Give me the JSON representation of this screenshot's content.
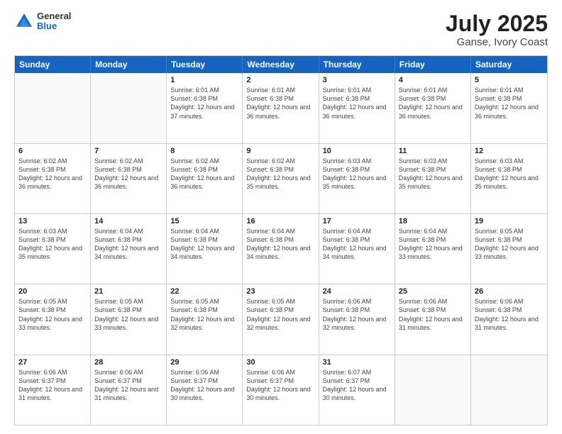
{
  "logo": {
    "line1": "General",
    "line2": "Blue"
  },
  "title": "July 2025",
  "subtitle": "Ganse, Ivory Coast",
  "days_of_week": [
    "Sunday",
    "Monday",
    "Tuesday",
    "Wednesday",
    "Thursday",
    "Friday",
    "Saturday"
  ],
  "weeks": [
    [
      {
        "day": "",
        "empty": true
      },
      {
        "day": "",
        "empty": true
      },
      {
        "day": "1",
        "sunrise": "Sunrise: 6:01 AM",
        "sunset": "Sunset: 6:38 PM",
        "daylight": "Daylight: 12 hours and 37 minutes."
      },
      {
        "day": "2",
        "sunrise": "Sunrise: 6:01 AM",
        "sunset": "Sunset: 6:38 PM",
        "daylight": "Daylight: 12 hours and 36 minutes."
      },
      {
        "day": "3",
        "sunrise": "Sunrise: 6:01 AM",
        "sunset": "Sunset: 6:38 PM",
        "daylight": "Daylight: 12 hours and 36 minutes."
      },
      {
        "day": "4",
        "sunrise": "Sunrise: 6:01 AM",
        "sunset": "Sunset: 6:38 PM",
        "daylight": "Daylight: 12 hours and 36 minutes."
      },
      {
        "day": "5",
        "sunrise": "Sunrise: 6:01 AM",
        "sunset": "Sunset: 6:38 PM",
        "daylight": "Daylight: 12 hours and 36 minutes."
      }
    ],
    [
      {
        "day": "6",
        "sunrise": "Sunrise: 6:02 AM",
        "sunset": "Sunset: 6:38 PM",
        "daylight": "Daylight: 12 hours and 36 minutes."
      },
      {
        "day": "7",
        "sunrise": "Sunrise: 6:02 AM",
        "sunset": "Sunset: 6:38 PM",
        "daylight": "Daylight: 12 hours and 36 minutes."
      },
      {
        "day": "8",
        "sunrise": "Sunrise: 6:02 AM",
        "sunset": "Sunset: 6:38 PM",
        "daylight": "Daylight: 12 hours and 36 minutes."
      },
      {
        "day": "9",
        "sunrise": "Sunrise: 6:02 AM",
        "sunset": "Sunset: 6:38 PM",
        "daylight": "Daylight: 12 hours and 35 minutes."
      },
      {
        "day": "10",
        "sunrise": "Sunrise: 6:03 AM",
        "sunset": "Sunset: 6:38 PM",
        "daylight": "Daylight: 12 hours and 35 minutes."
      },
      {
        "day": "11",
        "sunrise": "Sunrise: 6:03 AM",
        "sunset": "Sunset: 6:38 PM",
        "daylight": "Daylight: 12 hours and 35 minutes."
      },
      {
        "day": "12",
        "sunrise": "Sunrise: 6:03 AM",
        "sunset": "Sunset: 6:38 PM",
        "daylight": "Daylight: 12 hours and 35 minutes."
      }
    ],
    [
      {
        "day": "13",
        "sunrise": "Sunrise: 6:03 AM",
        "sunset": "Sunset: 6:38 PM",
        "daylight": "Daylight: 12 hours and 35 minutes."
      },
      {
        "day": "14",
        "sunrise": "Sunrise: 6:04 AM",
        "sunset": "Sunset: 6:38 PM",
        "daylight": "Daylight: 12 hours and 34 minutes."
      },
      {
        "day": "15",
        "sunrise": "Sunrise: 6:04 AM",
        "sunset": "Sunset: 6:38 PM",
        "daylight": "Daylight: 12 hours and 34 minutes."
      },
      {
        "day": "16",
        "sunrise": "Sunrise: 6:04 AM",
        "sunset": "Sunset: 6:38 PM",
        "daylight": "Daylight: 12 hours and 34 minutes."
      },
      {
        "day": "17",
        "sunrise": "Sunrise: 6:04 AM",
        "sunset": "Sunset: 6:38 PM",
        "daylight": "Daylight: 12 hours and 34 minutes."
      },
      {
        "day": "18",
        "sunrise": "Sunrise: 6:04 AM",
        "sunset": "Sunset: 6:38 PM",
        "daylight": "Daylight: 12 hours and 33 minutes."
      },
      {
        "day": "19",
        "sunrise": "Sunrise: 6:05 AM",
        "sunset": "Sunset: 6:38 PM",
        "daylight": "Daylight: 12 hours and 33 minutes."
      }
    ],
    [
      {
        "day": "20",
        "sunrise": "Sunrise: 6:05 AM",
        "sunset": "Sunset: 6:38 PM",
        "daylight": "Daylight: 12 hours and 33 minutes."
      },
      {
        "day": "21",
        "sunrise": "Sunrise: 6:05 AM",
        "sunset": "Sunset: 6:38 PM",
        "daylight": "Daylight: 12 hours and 33 minutes."
      },
      {
        "day": "22",
        "sunrise": "Sunrise: 6:05 AM",
        "sunset": "Sunset: 6:38 PM",
        "daylight": "Daylight: 12 hours and 32 minutes."
      },
      {
        "day": "23",
        "sunrise": "Sunrise: 6:05 AM",
        "sunset": "Sunset: 6:38 PM",
        "daylight": "Daylight: 12 hours and 32 minutes."
      },
      {
        "day": "24",
        "sunrise": "Sunrise: 6:06 AM",
        "sunset": "Sunset: 6:38 PM",
        "daylight": "Daylight: 12 hours and 32 minutes."
      },
      {
        "day": "25",
        "sunrise": "Sunrise: 6:06 AM",
        "sunset": "Sunset: 6:38 PM",
        "daylight": "Daylight: 12 hours and 31 minutes."
      },
      {
        "day": "26",
        "sunrise": "Sunrise: 6:06 AM",
        "sunset": "Sunset: 6:38 PM",
        "daylight": "Daylight: 12 hours and 31 minutes."
      }
    ],
    [
      {
        "day": "27",
        "sunrise": "Sunrise: 6:06 AM",
        "sunset": "Sunset: 6:37 PM",
        "daylight": "Daylight: 12 hours and 31 minutes."
      },
      {
        "day": "28",
        "sunrise": "Sunrise: 6:06 AM",
        "sunset": "Sunset: 6:37 PM",
        "daylight": "Daylight: 12 hours and 31 minutes."
      },
      {
        "day": "29",
        "sunrise": "Sunrise: 6:06 AM",
        "sunset": "Sunset: 6:37 PM",
        "daylight": "Daylight: 12 hours and 30 minutes."
      },
      {
        "day": "30",
        "sunrise": "Sunrise: 6:06 AM",
        "sunset": "Sunset: 6:37 PM",
        "daylight": "Daylight: 12 hours and 30 minutes."
      },
      {
        "day": "31",
        "sunrise": "Sunrise: 6:07 AM",
        "sunset": "Sunset: 6:37 PM",
        "daylight": "Daylight: 12 hours and 30 minutes."
      },
      {
        "day": "",
        "empty": true
      },
      {
        "day": "",
        "empty": true
      }
    ]
  ]
}
